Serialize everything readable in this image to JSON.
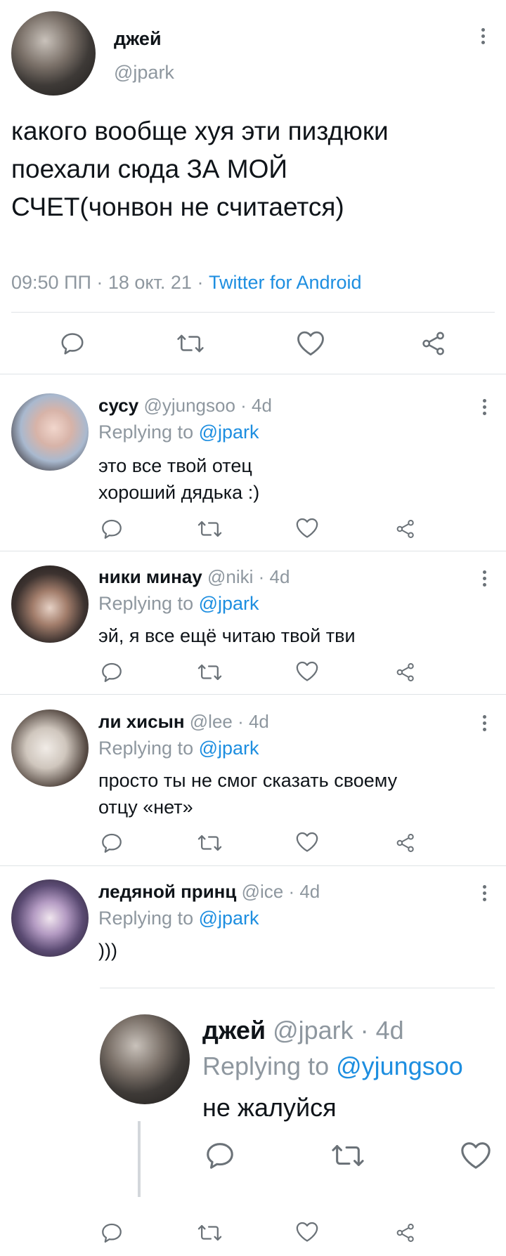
{
  "main_tweet": {
    "name": "джей",
    "handle": "@jpark",
    "text_line1": "какого вообще хуя эти пиздюки",
    "text_line2": "поехали сюда ЗА МОЙ",
    "text_line3": "СЧЕТ(чонвон не считается)",
    "timestamp": "09:50 ПП · 18 окт. 21 · ",
    "source": "Twitter for Android"
  },
  "replies": [
    {
      "name": "сусу",
      "meta": "@yjungsoo · 4d",
      "replying_prefix": "Replying to ",
      "replying_to": "@jpark",
      "line1": "это все твой отец",
      "line2": "хороший дядька :)"
    },
    {
      "name": "ники минау",
      "meta": "@niki · 4d",
      "replying_prefix": "Replying to ",
      "replying_to": "@jpark",
      "line1": "эй, я все ещё читаю твой тви"
    },
    {
      "name": "ли хисын",
      "meta": "@lee · 4d",
      "replying_prefix": "Replying to ",
      "replying_to": "@jpark",
      "line1": "просто ты не смог сказать своему",
      "line2": "отцу «нет»"
    },
    {
      "name": "ледяной принц",
      "meta": "@ice · 4d",
      "replying_prefix": "Replying to ",
      "replying_to": "@jpark",
      "line1": ")))"
    }
  ],
  "nested_reply": {
    "name": "джей",
    "meta": "@jpark · 4d",
    "replying_prefix": "Replying to ",
    "replying_to": "@yjungsoo",
    "line1": "не жалуйся"
  },
  "icons": [
    "reply-icon",
    "retweet-icon",
    "like-icon",
    "share-icon",
    "more-icon"
  ],
  "colors": {
    "link": "#1d8ee0",
    "muted": "#8e979f",
    "text": "#0f1419",
    "icon": "#6b7278"
  }
}
